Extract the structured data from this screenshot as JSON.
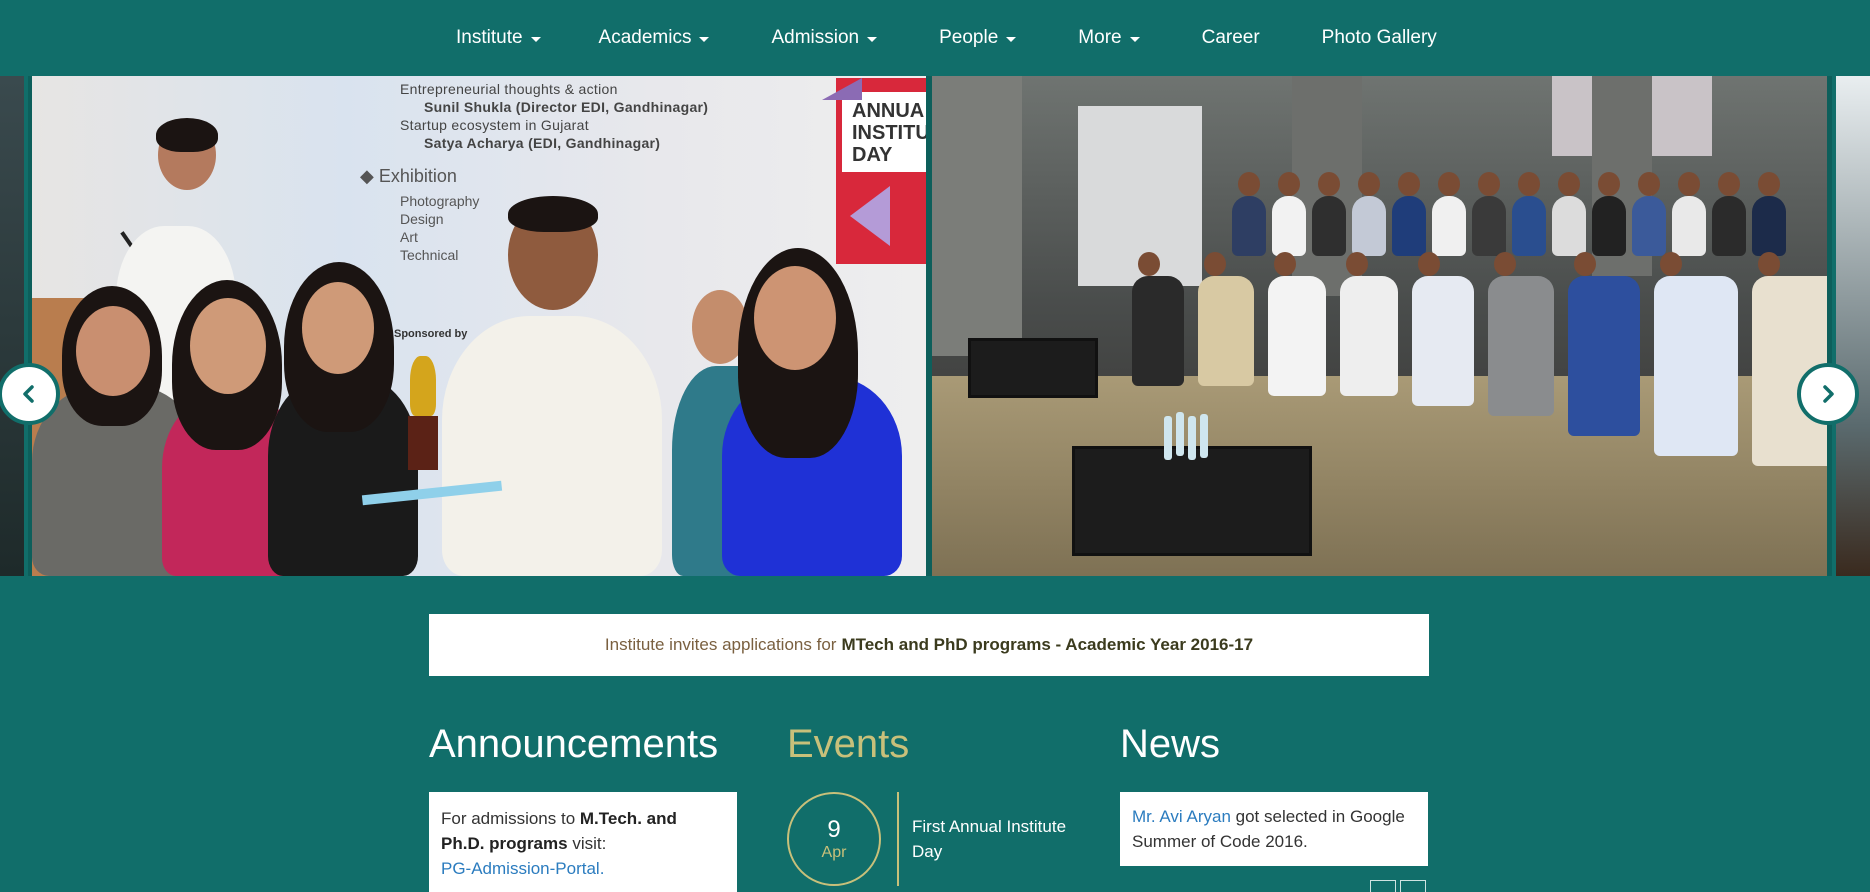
{
  "nav": {
    "items": [
      {
        "label": "Institute",
        "dropdown": true
      },
      {
        "label": "Academics",
        "dropdown": true
      },
      {
        "label": "Admission",
        "dropdown": true
      },
      {
        "label": "People",
        "dropdown": true
      },
      {
        "label": "More",
        "dropdown": true
      },
      {
        "label": "Career",
        "dropdown": false
      },
      {
        "label": "Photo Gallery",
        "dropdown": false
      }
    ]
  },
  "carousel": {
    "prev_icon": "chevron-left-icon",
    "next_icon": "chevron-right-icon",
    "poster": {
      "line1": "Entrepreneurial thoughts & action",
      "line2": "Sunil Shukla (Director EDI, Gandhinagar)",
      "line3": "Startup ecosystem in Gujarat",
      "line4": "Satya Acharya (EDI, Gandhinagar)",
      "exhibition": "Exhibition",
      "exhibition_items": [
        "Photography",
        "Design",
        "Art",
        "Technical"
      ],
      "sponsored": "Sponsored by",
      "annual": "ANNUA\nINSTITU\nDAY"
    }
  },
  "notice": {
    "prefix": "Institute invites applications for",
    "highlight": "MTech and PhD programs - Academic Year 2016-17"
  },
  "announcements": {
    "title": "Announcements",
    "text_prefix": "For admissions to ",
    "bold_text": "M.Tech. and Ph.D. programs",
    "text_suffix": " visit:",
    "link": "PG-Admission-Portal."
  },
  "events": {
    "title": "Events",
    "items": [
      {
        "day": "9",
        "month": "Apr",
        "title": "First Annual Institute Day"
      }
    ]
  },
  "news": {
    "title": "News",
    "link": "Mr. Avi Aryan",
    "text": " got selected in Google Summer of Code 2016."
  },
  "colors": {
    "background": "#116e6a",
    "events_accent": "#c8c07a",
    "link": "#2b7cbf"
  }
}
